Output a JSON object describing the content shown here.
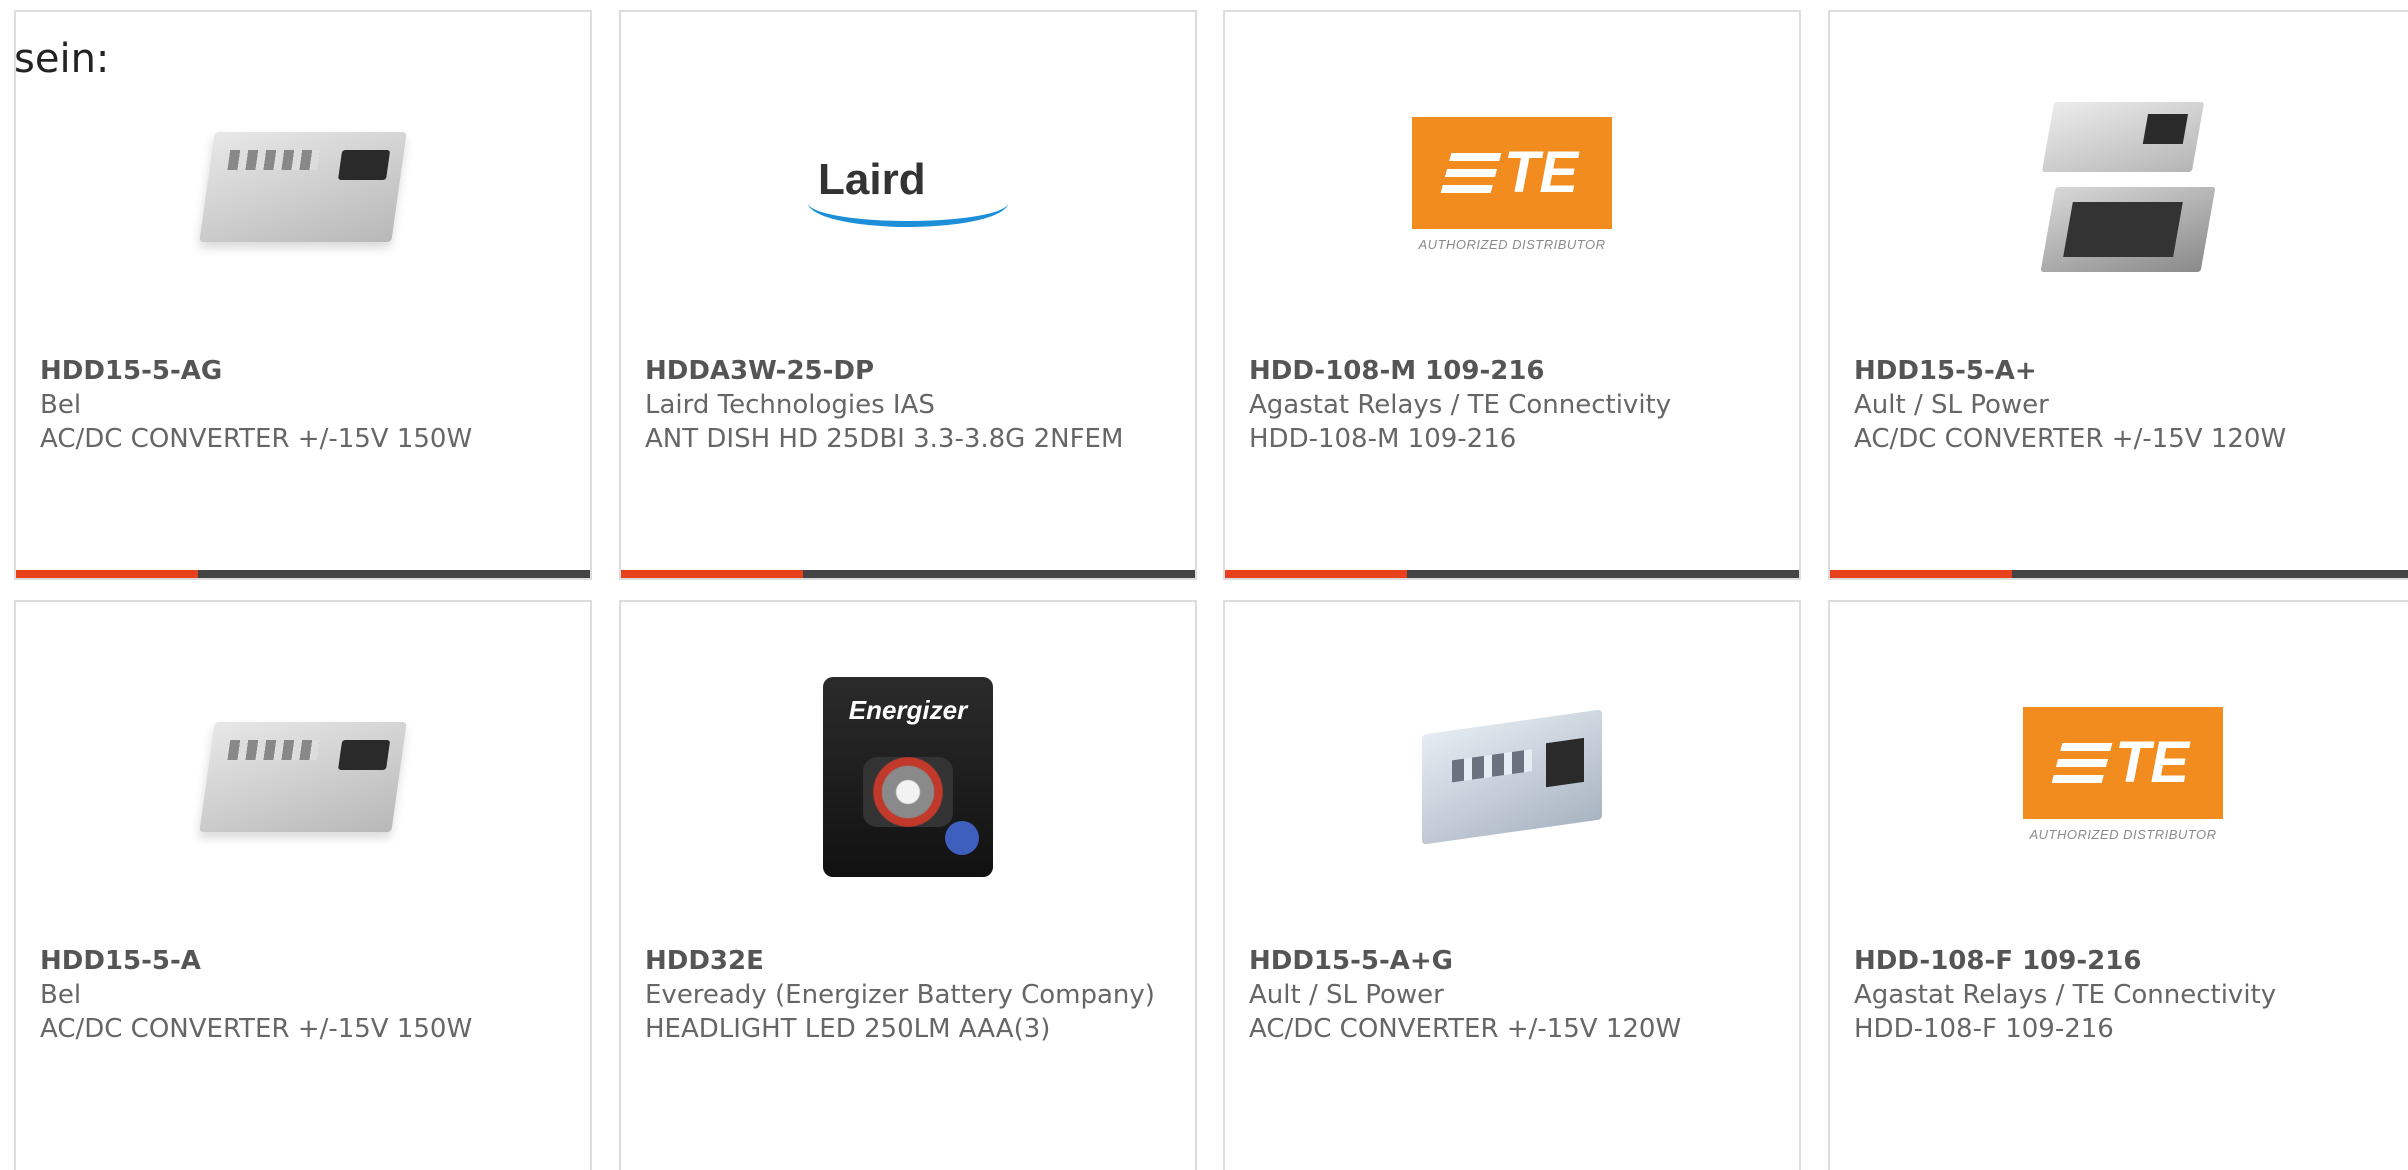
{
  "prefix_text": "sein:",
  "products": [
    {
      "part_number": "HDD15-5-AG",
      "manufacturer": "Bel",
      "description": "AC/DC CONVERTER +/-15V 150W",
      "image_icon": "power-supply-image"
    },
    {
      "part_number": "HDDA3W-25-DP",
      "manufacturer": "Laird Technologies IAS",
      "description": "ANT DISH HD 25DBI 3.3-3.8G 2NFEM",
      "image_icon": "laird-logo",
      "logo_text": "Laird"
    },
    {
      "part_number": "HDD-108-M 109-216",
      "manufacturer": "Agastat Relays / TE Connectivity",
      "description": "HDD-108-M 109-216",
      "image_icon": "te-connectivity-logo",
      "logo_text": "TE",
      "logo_caption": "AUTHORIZED DISTRIBUTOR"
    },
    {
      "part_number": "HDD15-5-A+",
      "manufacturer": "Ault / SL Power",
      "description": "AC/DC CONVERTER +/-15V 120W",
      "image_icon": "open-frame-power-supply-image"
    },
    {
      "part_number": "HDD15-5-A",
      "manufacturer": "Bel",
      "description": "AC/DC CONVERTER +/-15V 150W",
      "image_icon": "power-supply-image"
    },
    {
      "part_number": "HDD32E",
      "manufacturer": "Eveready (Energizer Battery Company)",
      "description": "HEADLIGHT LED 250LM AAA(3)",
      "image_icon": "energizer-headlight-image",
      "logo_text": "Energizer"
    },
    {
      "part_number": "HDD15-5-A+G",
      "manufacturer": "Ault / SL Power",
      "description": "AC/DC CONVERTER +/-15V 120W",
      "image_icon": "power-supply-image"
    },
    {
      "part_number": "HDD-108-F 109-216",
      "manufacturer": "Agastat Relays / TE Connectivity",
      "description": "HDD-108-F 109-216",
      "image_icon": "te-connectivity-logo",
      "logo_text": "TE",
      "logo_caption": "AUTHORIZED DISTRIBUTOR"
    }
  ],
  "colors": {
    "accent": "#e8401c",
    "bar": "#444444",
    "te_orange": "#f28c1e",
    "laird_blue": "#1c8fd8"
  }
}
